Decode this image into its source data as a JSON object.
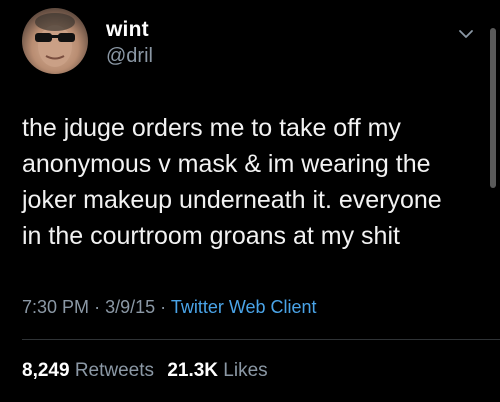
{
  "tweet": {
    "display_name": "wint",
    "handle": "@dril",
    "text": "the jduge orders me to take off my\nanonymous v mask & im wearing the\njoker makeup underneath it. everyone\nin the courtroom groans at my shit",
    "time": "7:30 PM",
    "separator": "·",
    "date": "3/9/15",
    "source": "Twitter Web Client",
    "retweets_count": "8,249",
    "retweets_label": "Retweets",
    "likes_count": "21.3K",
    "likes_label": "Likes"
  },
  "icons": {
    "menu": "chevron-down-icon",
    "avatar": "avatar-photo"
  },
  "colors": {
    "background": "#000000",
    "text": "#ffffff",
    "secondary": "#8b98a5",
    "link": "#4aa4e8"
  }
}
